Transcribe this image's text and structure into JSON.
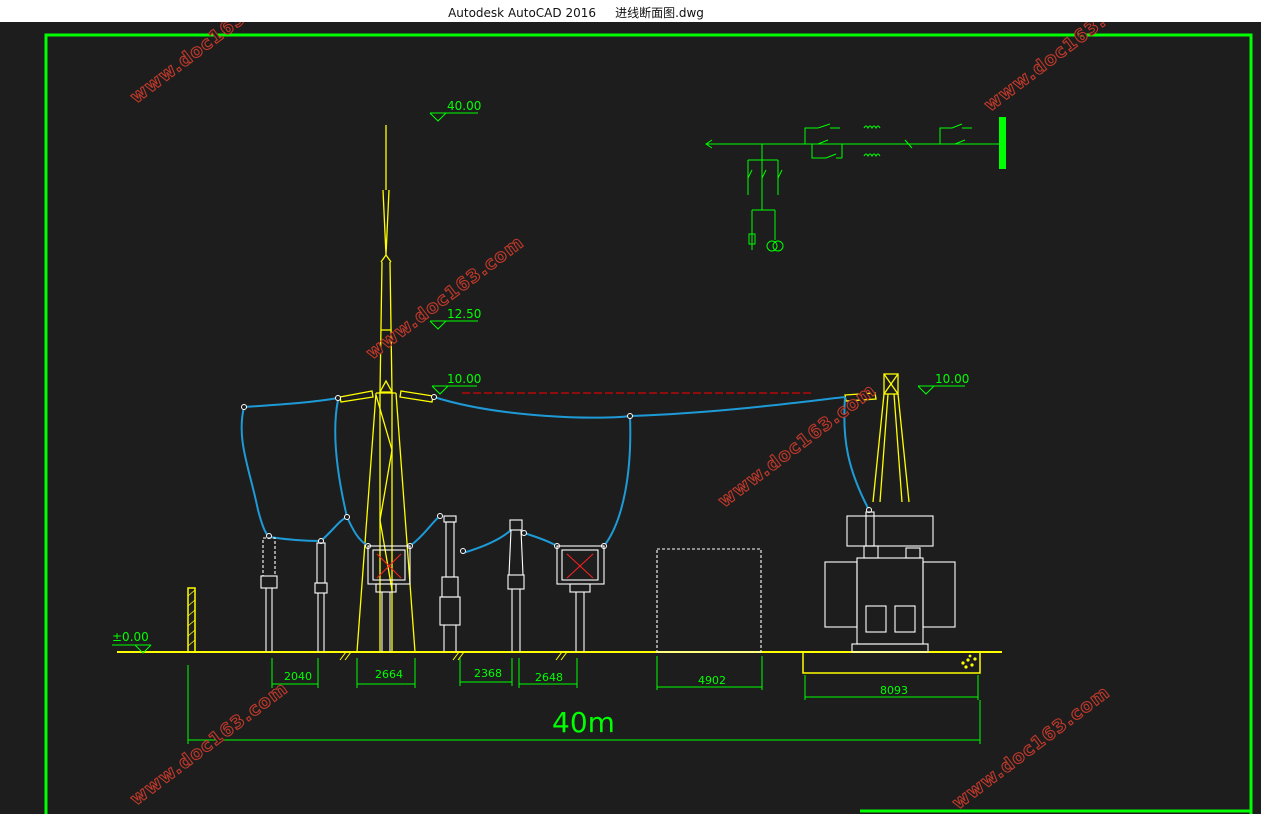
{
  "window": {
    "app_title": "Autodesk AutoCAD 2016",
    "file_name": "进线断面图.dwg"
  },
  "colors": {
    "background": "#1d1d1d",
    "frame": "#00ff00",
    "structure": "#ffff00",
    "conductor": "#1e9bd7",
    "equipment": "#ffffff",
    "dimension": "#00ff00",
    "centerline": "#ff0000",
    "watermark": "#c0392b"
  },
  "elevations": {
    "lightning_rod_top": "40.00",
    "tower_mid": "12.50",
    "tower_left": "10.00",
    "tower_right": "10.00",
    "ground": "±0.00"
  },
  "dimensions": {
    "d1": "2040",
    "d2": "2664",
    "d3": "2368",
    "d4": "2648",
    "d5": "4902",
    "d6": "8093",
    "total": "40m"
  },
  "watermark_text": "www.doc163.com"
}
